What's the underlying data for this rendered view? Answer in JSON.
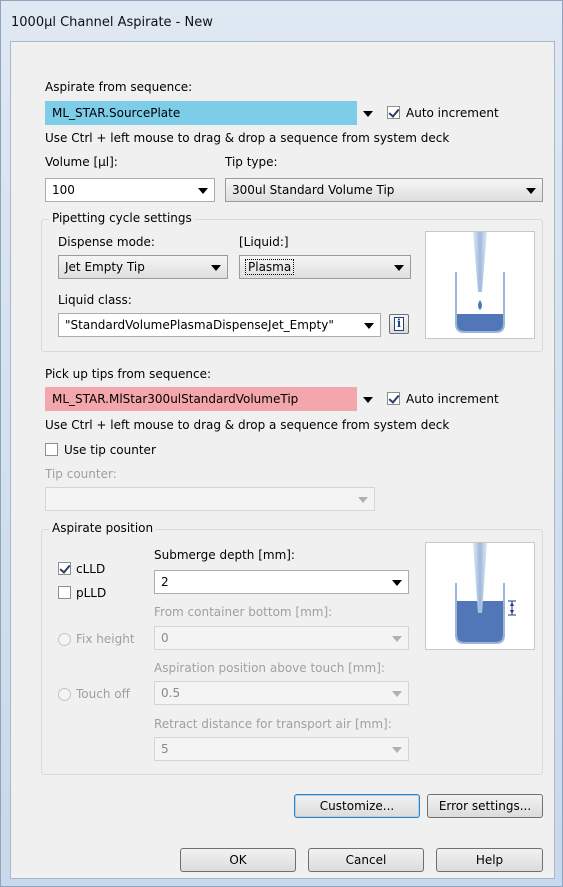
{
  "window": {
    "title": "1000µl Channel Aspirate - New"
  },
  "aspirate": {
    "sequence_label": "Aspirate from sequence:",
    "sequence_value": "ML_STAR.SourcePlate",
    "sequence_color": "#7ecde8",
    "auto_increment_label": "Auto increment",
    "auto_increment_checked": true,
    "hint": "Use Ctrl + left mouse to drag & drop a sequence from system deck",
    "volume_label": "Volume [µl]:",
    "volume_value": "100",
    "tip_type_label": "Tip type:",
    "tip_type_value": "300ul Standard Volume Tip"
  },
  "pipetting": {
    "group_title": "Pipetting cycle settings",
    "dispense_mode_label": "Dispense mode:",
    "dispense_mode_value": "Jet Empty Tip",
    "liquid_label": "[Liquid:]",
    "liquid_value": "Plasma",
    "liquid_class_label": "Liquid class:",
    "liquid_class_value": "\"StandardVolumePlasmaDispenseJet_Empty\"",
    "info_icon_glyph": "i"
  },
  "tips": {
    "sequence_label": "Pick up tips from sequence:",
    "sequence_value": "ML_STAR.MlStar300ulStandardVolumeTip",
    "sequence_color": "#f4a6ad",
    "auto_increment_label": "Auto increment",
    "auto_increment_checked": true,
    "hint": "Use Ctrl + left mouse to drag & drop a sequence from system deck",
    "use_tip_counter_label": "Use tip counter",
    "use_tip_counter_checked": false,
    "tip_counter_label": "Tip counter:",
    "tip_counter_value": ""
  },
  "aspirate_position": {
    "group_title": "Aspirate position",
    "clld_label": "cLLD",
    "clld_checked": true,
    "plld_label": "pLLD",
    "plld_checked": false,
    "submerge_label": "Submerge depth [mm]:",
    "submerge_value": "2",
    "fix_height_label": "Fix height",
    "from_bottom_label": "From container bottom [mm]:",
    "from_bottom_value": "0",
    "touch_off_label": "Touch off",
    "above_touch_label": "Aspiration position above touch [mm]:",
    "above_touch_value": "0.5",
    "retract_label": "Retract distance for transport air [mm]:",
    "retract_value": "5"
  },
  "buttons": {
    "customize": "Customize...",
    "error_settings": "Error settings...",
    "ok": "OK",
    "cancel": "Cancel",
    "help": "Help"
  }
}
